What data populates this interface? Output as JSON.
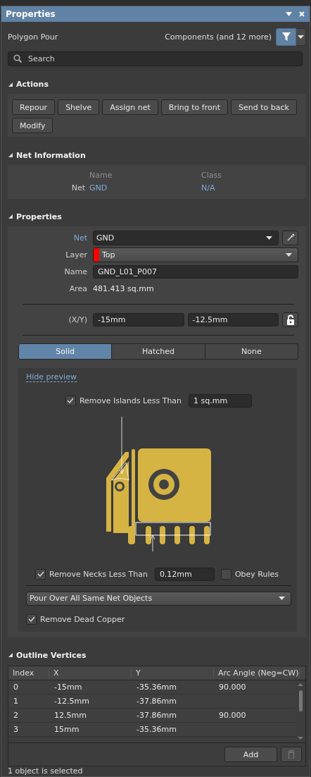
{
  "window": {
    "title": "Properties"
  },
  "header": {
    "object_type": "Polygon Pour",
    "filter_label": "Components (and 12 more)"
  },
  "search": {
    "placeholder": "Search"
  },
  "actions": {
    "heading": "Actions",
    "buttons": [
      "Repour",
      "Shelve",
      "Assign net",
      "Bring to front",
      "Send to back",
      "Modify"
    ]
  },
  "net_information": {
    "heading": "Net Information",
    "columns": [
      "Name",
      "Class"
    ],
    "row_label": "Net",
    "name": "GND",
    "class": "N/A"
  },
  "properties": {
    "heading": "Properties",
    "net": {
      "label": "Net",
      "value": "GND"
    },
    "layer": {
      "label": "Layer",
      "value": "Top",
      "color": "#ff0000"
    },
    "name": {
      "label": "Name",
      "value": "GND_L01_P007"
    },
    "area": {
      "label": "Area",
      "value": "481.413 sq.mm"
    },
    "xy": {
      "label": "(X/Y)",
      "x": "-15mm",
      "y": "-12.5mm",
      "locked": false
    },
    "fill_modes": [
      {
        "label": "Solid",
        "selected": true
      },
      {
        "label": "Hatched",
        "selected": false
      },
      {
        "label": "None",
        "selected": false
      }
    ],
    "preview": {
      "link": "Hide preview",
      "remove_islands": {
        "label": "Remove Islands Less Than",
        "checked": true,
        "value": "1 sq.mm"
      },
      "remove_necks": {
        "label": "Remove Necks Less Than",
        "checked": true,
        "value": "0.12mm"
      },
      "obey_rules": {
        "label": "Obey Rules",
        "checked": false
      },
      "pour_mode": "Pour Over All Same Net Objects",
      "remove_dead_copper": {
        "label": "Remove Dead Copper",
        "checked": true
      }
    }
  },
  "outline_vertices": {
    "heading": "Outline Vertices",
    "columns": [
      "Index",
      "X",
      "Y",
      "Arc Angle (Neg=CW)"
    ],
    "rows": [
      {
        "index": "0",
        "x": "-15mm",
        "y": "-35.36mm",
        "arc_angle": "90.000"
      },
      {
        "index": "1",
        "x": "-12.5mm",
        "y": "-37.86mm"
      },
      {
        "index": "2",
        "x": "12.5mm",
        "y": "-37.86mm",
        "arc_angle": "90.000"
      },
      {
        "index": "3",
        "x": "15mm",
        "y": "-35.36mm"
      }
    ],
    "add_button": "Add"
  },
  "status_bar": "1 object is selected"
}
